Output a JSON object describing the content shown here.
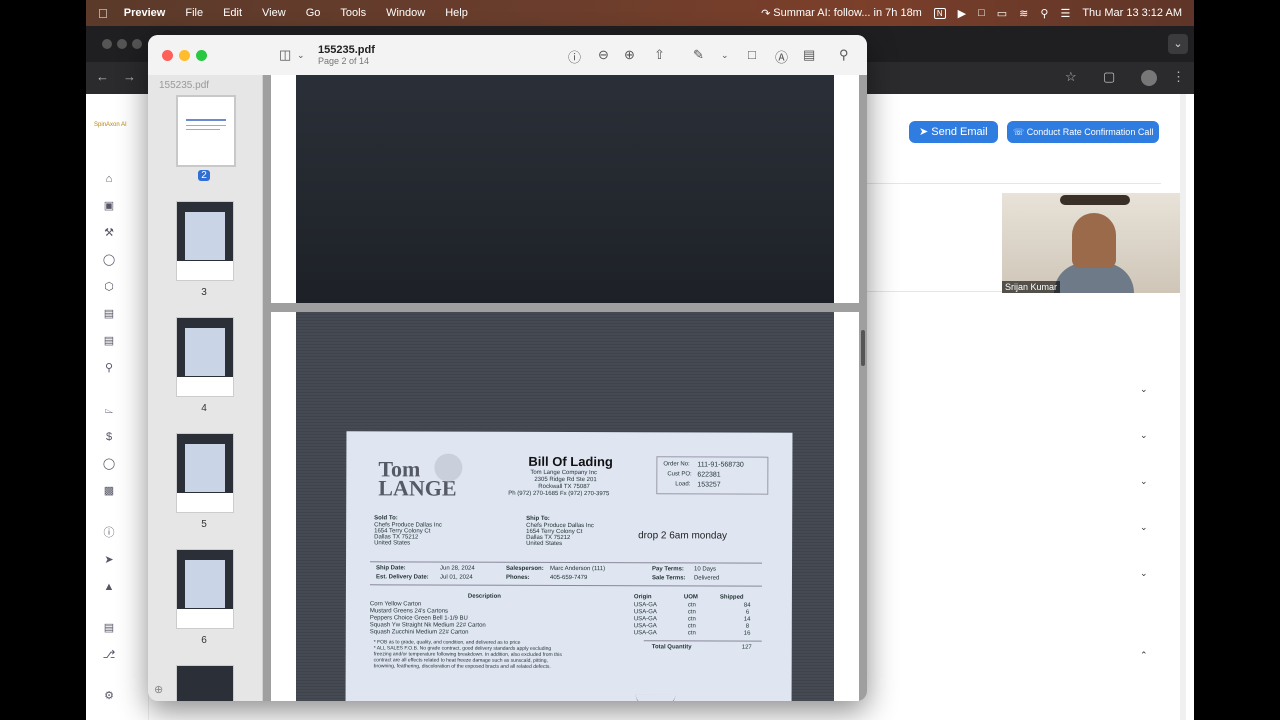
{
  "menubar": {
    "app": "Preview",
    "menus": [
      "File",
      "Edit",
      "View",
      "Go",
      "Tools",
      "Window",
      "Help"
    ],
    "meeting": "Summar AI: follow... in 7h 18m",
    "datetime": "Thu Mar 13  3:12 AM"
  },
  "browser": {
    "send_email": "Send Email",
    "rate_call": "Conduct Rate Confirmation Call",
    "video_name": "Srijan Kumar",
    "logo_text": "SpinAxon AI"
  },
  "preview": {
    "filename": "155235.pdf",
    "page_info": "Page 2 of 14",
    "sidebar_file": "155235.pdf",
    "thumbs": [
      {
        "num": "2",
        "selected": true
      },
      {
        "num": "3"
      },
      {
        "num": "4"
      },
      {
        "num": "5"
      },
      {
        "num": "6"
      }
    ]
  },
  "bol": {
    "logo_line1": "Tom",
    "logo_line2": "LANGE",
    "title": "Bill Of Lading",
    "company": "Tom Lange Company Inc",
    "addr1": "2305 Ridge Rd Ste 201",
    "addr2": "Rockwall TX 75087",
    "phone": "Ph (972) 270-1685  Fx (972) 270-3975",
    "order_label": "Order No:",
    "order_no": "111-91-568730",
    "cust_label": "Cust PO:",
    "cust_po": "622381",
    "load_label": "Load:",
    "load_no": "153257",
    "sold_to_label": "Sold To:",
    "sold_to": [
      "Chefs Produce Dallas Inc",
      "1654 Terry Colony Ct",
      "Dallas TX 75212",
      "United States"
    ],
    "ship_to_label": "Ship To:",
    "ship_to": [
      "Chefs Produce Dallas Inc",
      "1654 Terry Colony Ct",
      "Dallas TX 75212",
      "United States"
    ],
    "drop_note": "drop 2 6am monday",
    "ship_date_label": "Ship Date:",
    "ship_date": "Jun 28, 2024",
    "est_label": "Est. Delivery Date:",
    "est_date": "Jul 01, 2024",
    "sales_label": "Salesperson:",
    "salesperson": "Marc Anderson (111)",
    "phone_label": "Phones:",
    "sales_phone": "405-659-7479",
    "pay_label": "Pay Terms:",
    "pay_terms": "10 Days",
    "sale_label": "Sale Terms:",
    "sale_terms": "Delivered",
    "col_desc": "Description",
    "col_origin": "Origin",
    "col_uom": "UOM",
    "col_shipped": "Shipped",
    "items": [
      {
        "desc": "Corn Yellow Carton",
        "origin": "USA-GA",
        "uom": "ctn",
        "qty": "84"
      },
      {
        "desc": "Mustard Greens 24's Cartons",
        "origin": "USA-GA",
        "uom": "ctn",
        "qty": "6"
      },
      {
        "desc": "Peppers Choice Green Bell 1-1/9 BU",
        "origin": "USA-GA",
        "uom": "ctn",
        "qty": "14"
      },
      {
        "desc": "Squash Yw Straight Nk Medium 22# Carton",
        "origin": "USA-GA",
        "uom": "ctn",
        "qty": "8"
      },
      {
        "desc": "Squash Zucchini Medium 22# Carton",
        "origin": "USA-GA",
        "uom": "ctn",
        "qty": "16"
      }
    ],
    "total_label": "Total Quantity",
    "total_qty": "127",
    "footnote1": "* FOB as to grade, quality, and condition, and delivered as to price",
    "footnote2": "* ALL SALES F.O.B. No grade contract, good delivery standards apply excluding",
    "footnote3": "freezing and/or temperature following breakdown. In addition, also excluded from this",
    "footnote4": "contract are all effects related to heat freeze damage such as sunscald, pitting,",
    "footnote5": "browning, feathering, discoloration of the exposed bracts and all related defects."
  }
}
